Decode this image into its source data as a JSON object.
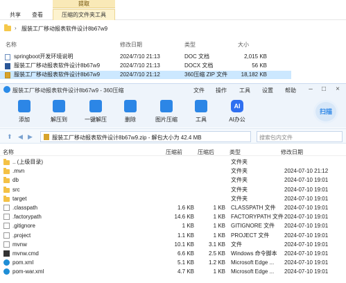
{
  "explorer": {
    "ribbon": {
      "context_group": "提取",
      "tabs": [
        "共享",
        "查看"
      ],
      "context_tab": "压缩的文件夹工具"
    },
    "address": {
      "path": "服装工厂移动报表软件设计8b67w9"
    },
    "columns": {
      "name": "名称",
      "modified": "修改日期",
      "type": "类型",
      "size": "大小"
    },
    "files": [
      {
        "name": "springboot开发环境说明",
        "modified": "2024/7/10 21:13",
        "type": "DOC 文档",
        "size": "2,015 KB",
        "icon": "doc-icon"
      },
      {
        "name": "服装工厂移动报表软件设计8b67w9",
        "modified": "2024/7/10 21:13",
        "type": "DOCX 文档",
        "size": "56 KB",
        "icon": "word-icon"
      },
      {
        "name": "服装工厂移动报表软件设计8b67w9",
        "modified": "2024/7/10 21:12",
        "type": "360压缩 ZIP 文件",
        "size": "18,182 KB",
        "icon": "zip-icon",
        "selected": true
      }
    ]
  },
  "zipwin": {
    "title": "服装工厂移动报表软件设计8b67w9 - 360压缩",
    "menu": [
      "文件",
      "操作",
      "工具",
      "设置",
      "帮助"
    ],
    "toolbar": [
      {
        "label": "添加",
        "icon": "add-icon"
      },
      {
        "label": "解压到",
        "icon": "extract-icon"
      },
      {
        "label": "一键解压",
        "icon": "one-click-extract-icon"
      },
      {
        "label": "删除",
        "icon": "delete-icon"
      },
      {
        "label": "图片压缩",
        "icon": "image-compress-icon"
      },
      {
        "label": "工具",
        "icon": "tools-icon"
      },
      {
        "label": "AI办公",
        "icon": "ai-icon",
        "icon_text": "AI"
      }
    ],
    "scan_label": "扫描",
    "path_text": "服装工厂移动报表软件设计8b67w9.zip - 解包大小为 42.4 MB",
    "search_placeholder": "搜索包内文件",
    "columns": {
      "name": "名称",
      "compressed": "压缩前",
      "packed": "压缩后",
      "type": "类型",
      "modified": "修改日期"
    },
    "rows": [
      {
        "name": ".. (上级目录)",
        "compressed": "",
        "packed": "",
        "type": "文件夹",
        "modified": "",
        "icon": "folder"
      },
      {
        "name": ".mvn",
        "compressed": "",
        "packed": "",
        "type": "文件夹",
        "modified": "2024-07-10 21:12",
        "icon": "folder"
      },
      {
        "name": "db",
        "compressed": "",
        "packed": "",
        "type": "文件夹",
        "modified": "2024-07-10 19:01",
        "icon": "folder"
      },
      {
        "name": "src",
        "compressed": "",
        "packed": "",
        "type": "文件夹",
        "modified": "2024-07-10 19:01",
        "icon": "folder"
      },
      {
        "name": "target",
        "compressed": "",
        "packed": "",
        "type": "文件夹",
        "modified": "2024-07-10 19:01",
        "icon": "folder"
      },
      {
        "name": ".classpath",
        "compressed": "1.6 KB",
        "packed": "1 KB",
        "type": "CLASSPATH 文件",
        "modified": "2024-07-10 19:01",
        "icon": "file"
      },
      {
        "name": ".factorypath",
        "compressed": "14.6 KB",
        "packed": "1 KB",
        "type": "FACTORYPATH 文件",
        "modified": "2024-07-10 19:01",
        "icon": "file"
      },
      {
        "name": ".gitignore",
        "compressed": "1 KB",
        "packed": "1 KB",
        "type": "GITIGNORE 文件",
        "modified": "2024-07-10 19:01",
        "icon": "file"
      },
      {
        "name": ".project",
        "compressed": "1.1 KB",
        "packed": "1 KB",
        "type": "PROJECT 文件",
        "modified": "2024-07-10 19:01",
        "icon": "file"
      },
      {
        "name": "mvnw",
        "compressed": "10.1 KB",
        "packed": "3.1 KB",
        "type": "文件",
        "modified": "2024-07-10 19:01",
        "icon": "file"
      },
      {
        "name": "mvnw.cmd",
        "compressed": "6.6 KB",
        "packed": "2.5 KB",
        "type": "Windows 命令脚本",
        "modified": "2024-07-10 19:01",
        "icon": "cmd"
      },
      {
        "name": "pom.xml",
        "compressed": "5.1 KB",
        "packed": "1.2 KB",
        "type": "Microsoft Edge ...",
        "modified": "2024-07-10 19:01",
        "icon": "edge"
      },
      {
        "name": "pom-war.xml",
        "compressed": "4.7 KB",
        "packed": "1 KB",
        "type": "Microsoft Edge ...",
        "modified": "2024-07-10 19:01",
        "icon": "edge"
      }
    ]
  }
}
